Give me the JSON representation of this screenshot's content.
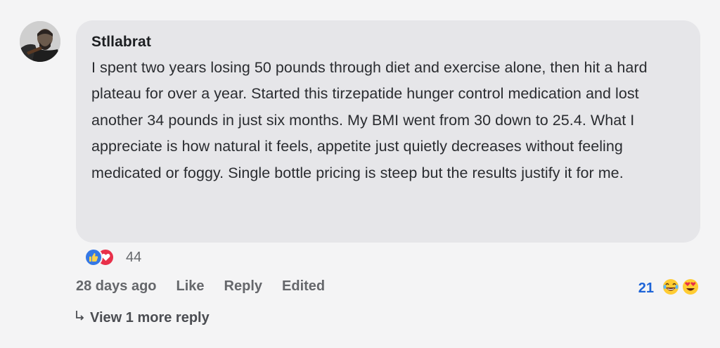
{
  "comment": {
    "author": "Stllabrat",
    "text": "I spent two years losing 50 pounds through diet and exercise alone, then hit a hard plateau for over a year. Started this tirzepatide hunger control medication and lost another 34 pounds in just six months. My BMI went from 30 down to 25.4. What I appreciate is how natural it feels, appetite just quietly decreases without feeling medicated or foggy. Single bottle pricing is steep but the results justify it for me."
  },
  "reactions": {
    "icons": [
      "thumbs-up-icon",
      "heart-icon"
    ],
    "count": "44"
  },
  "actions": {
    "timestamp": "28 days ago",
    "like_label": "Like",
    "reply_label": "Reply",
    "edited_label": "Edited"
  },
  "reply_reactions": {
    "count": "21",
    "icons": [
      "laughing-emoji-icon",
      "heart-eyes-emoji-icon"
    ]
  },
  "view_more": {
    "label": "View 1 more reply"
  },
  "colors": {
    "background": "#f4f4f5",
    "bubble": "#e6e6e9",
    "link_blue": "#1d64d8",
    "like_blue": "#3578e5",
    "love_red": "#e8304a",
    "muted": "#65676b"
  }
}
